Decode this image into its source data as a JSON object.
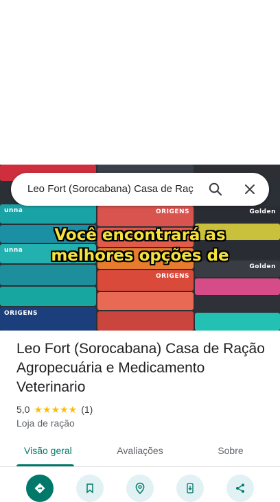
{
  "search": {
    "query": "Leo Fort (Sorocabana) Casa de Raç"
  },
  "hero": {
    "caption_line1": "Você encontrará as",
    "caption_line2": "melhores opções de",
    "bag_brands": [
      "unna",
      "ORIGENS",
      "Golden"
    ]
  },
  "place": {
    "title": "Leo Fort (Sorocabana) Casa de Ração Agropecuária e Medicamento Veterinario",
    "rating": "5,0",
    "stars": "★★★★★",
    "review_count": "(1)",
    "category": "Loja de ração"
  },
  "tabs": [
    {
      "label": "Visão geral",
      "active": true
    },
    {
      "label": "Avaliações",
      "active": false
    },
    {
      "label": "Sobre",
      "active": false
    }
  ],
  "actions": [
    {
      "icon": "directions-icon"
    },
    {
      "icon": "save-bookmark-icon"
    },
    {
      "icon": "nearby-icon"
    },
    {
      "icon": "send-to-phone-icon"
    },
    {
      "icon": "share-icon"
    }
  ],
  "colors": {
    "accent": "#00796b",
    "star": "#fbbc04",
    "caption": "#f5e23b"
  }
}
